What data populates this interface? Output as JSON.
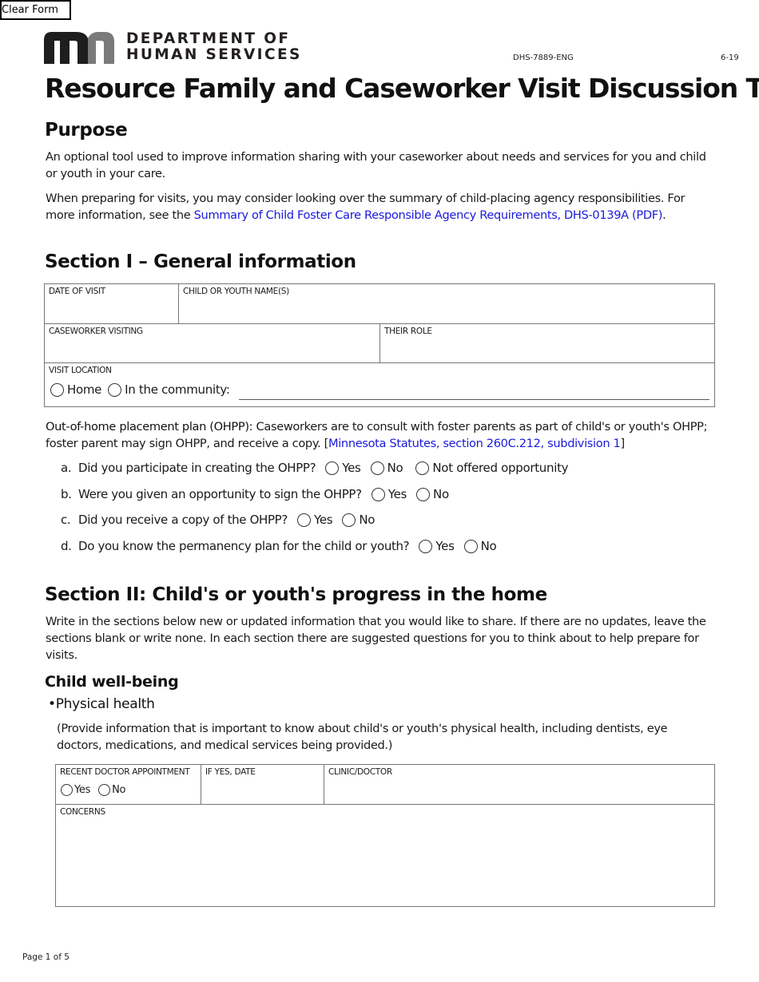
{
  "toolbar": {
    "clear_form_label": "Clear Form"
  },
  "header": {
    "logo_line1": "DEPARTMENT OF",
    "logo_line2": "HUMAN SERVICES",
    "form_id": "DHS-7889-ENG",
    "form_date": "6-19",
    "title": "Resource Family and Caseworker Visit Discussion Tool"
  },
  "purpose": {
    "heading": "Purpose",
    "para1": "An optional tool used to improve information sharing with your caseworker about needs and services for you and child or youth in your care.",
    "para2_prefix": "When preparing for visits, you may consider looking over the summary of child-placing agency responsibilities. For more information, see the ",
    "para2_link": "Summary of Child Foster Care Responsible Agency Requirements, DHS-0139A (PDF)",
    "para2_suffix": "."
  },
  "section1": {
    "heading": "Section I – General information",
    "fields": {
      "date_of_visit": "DATE OF VISIT",
      "child_names": "CHILD OR YOUTH NAME(S)",
      "caseworker_visiting": "CASEWORKER VISITING",
      "their_role": "THEIR ROLE",
      "visit_location": "VISIT LOCATION"
    },
    "location_options": [
      "Home",
      "In the community:"
    ],
    "ohpp": {
      "lead": "Out-of-home placement plan (OHPP):",
      "text": " Caseworkers are to consult with foster parents as part of child's or youth's OHPP; foster parent may sign OHPP, and receive a copy. [",
      "link": "Minnesota Statutes, section 260C.212, subdivision 1",
      "close": "]"
    },
    "questions": [
      {
        "letter": "a.",
        "text": "Did you participate in creating the OHPP?",
        "options": [
          "Yes",
          "No",
          "Not offered opportunity"
        ]
      },
      {
        "letter": "b.",
        "text": "Were you given an opportunity to sign the OHPP?",
        "options": [
          "Yes",
          "No"
        ]
      },
      {
        "letter": "c.",
        "text": "Did you receive a copy of the OHPP?",
        "options": [
          "Yes",
          "No"
        ]
      },
      {
        "letter": "d.",
        "text": "Do you know the permanency plan for the child or youth?",
        "options": [
          "Yes",
          "No"
        ]
      }
    ]
  },
  "section2": {
    "heading": "Section II: Child's or youth's progress in the home",
    "intro": "Write in the sections below new or updated information that you would like to share. If there are no updates, leave the sections blank or write none. In each section there are suggested questions for you to think about to help prepare for visits.",
    "subheading": "Child well-being",
    "bullet": "Physical health",
    "bullet_note": "(Provide information that is important to know about child's or youth's physical health, including dentists, eye doctors, medications, and medical services being provided.)",
    "table": {
      "recent_appt": "RECENT DOCTOR APPOINTMENT",
      "appt_options": [
        "Yes",
        "No"
      ],
      "if_yes_date": "IF YES, DATE",
      "clinic_doctor": "CLINIC/DOCTOR",
      "concerns": "CONCERNS"
    }
  },
  "footer": {
    "page": "Page 1 of 5"
  }
}
